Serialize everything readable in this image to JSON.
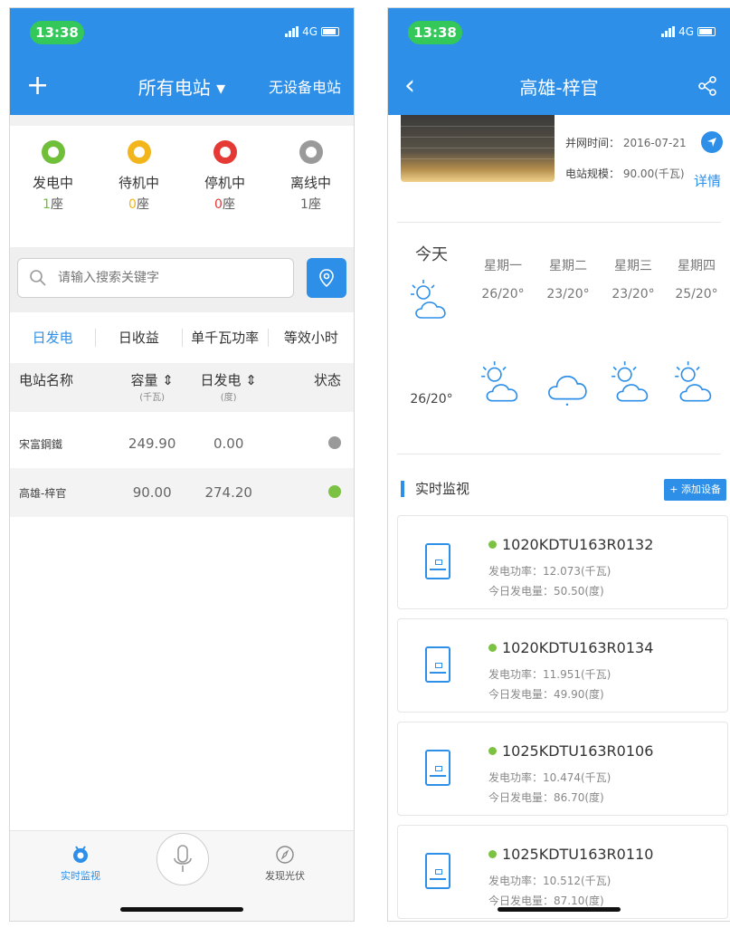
{
  "status_bar": {
    "time": "13:38",
    "network": "4G"
  },
  "left_screen": {
    "nav": {
      "add_icon": "+",
      "title": "所有电站 ▾",
      "right": "无设备电站"
    },
    "status_cards": [
      {
        "label": "发电中",
        "count": "1",
        "unit": "座",
        "pin_color": "#6fbf3a",
        "count_color": "#6fbf3a"
      },
      {
        "label": "待机中",
        "count": "0",
        "unit": "座",
        "pin_color": "#f2b51b",
        "count_color": "#f2b51b"
      },
      {
        "label": "停机中",
        "count": "0",
        "unit": "座",
        "pin_color": "#e53935",
        "count_color": "#e53935"
      },
      {
        "label": "离线中",
        "count": "1",
        "unit": "座",
        "pin_color": "#9a9a9a",
        "count_color": "#666666"
      }
    ],
    "search": {
      "placeholder": "请输入搜索关键字"
    },
    "tabs": [
      "日发电",
      "日收益",
      "单千瓦功率",
      "等效小时"
    ],
    "table": {
      "headers": {
        "name": "电站名称",
        "capacity": "容量 ⇕",
        "capacity_unit": "(千瓦)",
        "daily": "日发电 ⇕",
        "daily_unit": "(度)",
        "status": "状态"
      },
      "rows": [
        {
          "name": "宋富鋼鐵",
          "capacity": "249.90",
          "daily": "0.00",
          "status_color": "#9a9a9a"
        },
        {
          "name": "高雄-梓官",
          "capacity": "90.00",
          "daily": "274.20",
          "status_color": "#7cc242"
        }
      ]
    },
    "tabbar": {
      "monitor_label": "实时监视",
      "discover_label": "发现光伏"
    }
  },
  "right_screen": {
    "nav": {
      "back": "‹",
      "title": "高雄-梓官",
      "share_icon": "share-icon"
    },
    "info": {
      "grid_time_label": "并网时间：",
      "grid_time_value": "2016-07-21",
      "scale_label": "电站规模：",
      "scale_value": "90.00(千瓦)",
      "detail": "详情"
    },
    "weather": {
      "today_label": "今天",
      "today_temp": "26/20°",
      "days": [
        {
          "day": "星期一",
          "temp": "26/20°",
          "icon": "partly-cloudy"
        },
        {
          "day": "星期二",
          "temp": "23/20°",
          "icon": "cloudy"
        },
        {
          "day": "星期三",
          "temp": "23/20°",
          "icon": "partly-cloudy"
        },
        {
          "day": "星期四",
          "temp": "25/20°",
          "icon": "partly-cloudy"
        }
      ]
    },
    "section_title": "实时监视",
    "add_device": "+ 添加设备",
    "devices": [
      {
        "id": "1020KDTU163R0132",
        "power": "发电功率：12.073(千瓦)",
        "today": "今日发电量：50.50(度)"
      },
      {
        "id": "1020KDTU163R0134",
        "power": "发电功率：11.951(千瓦)",
        "today": "今日发电量：49.90(度)"
      },
      {
        "id": "1025KDTU163R0106",
        "power": "发电功率：10.474(千瓦)",
        "today": "今日发电量：86.70(度)"
      },
      {
        "id": "1025KDTU163R0110",
        "power": "发电功率：10.512(千瓦)",
        "today": "今日发电量：87.10(度)"
      }
    ]
  },
  "colors": {
    "primary": "#2d8fe8",
    "online": "#7cc242",
    "offline": "#9a9a9a",
    "time_pill": "#34c759"
  }
}
